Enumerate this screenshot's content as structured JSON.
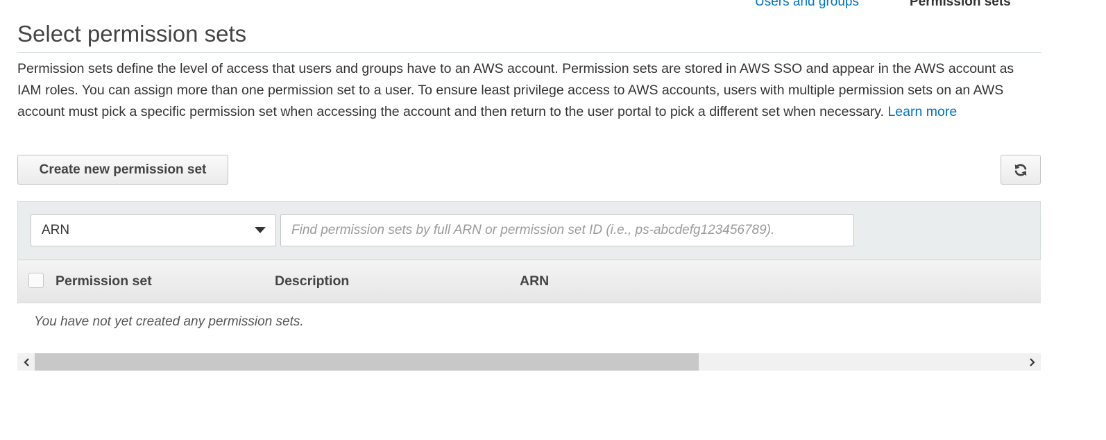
{
  "steps": {
    "users_and_groups": "Users and groups",
    "permission_sets": "Permission sets"
  },
  "page": {
    "title": "Select permission sets",
    "description": "Permission sets define the level of access that users and groups have to an AWS account. Permission sets are stored in AWS SSO and appear in the AWS account as IAM roles. You can assign more than one permission set to a user. To ensure least privilege access to AWS accounts, users with multiple permission sets on an AWS account must pick a specific permission set when accessing the account and then return to the user portal to pick a different set when necessary.",
    "learn_more": "Learn more"
  },
  "toolbar": {
    "create_label": "Create new permission set",
    "refresh_icon": "refresh-icon"
  },
  "filter": {
    "selected": "ARN",
    "placeholder": "Find permission sets by full ARN or permission set ID (i.e., ps-abcdefg123456789)."
  },
  "table": {
    "columns": [
      "Permission set",
      "Description",
      "ARN"
    ],
    "empty_message": "You have not yet created any permission sets."
  },
  "colors": {
    "link": "#0073bb",
    "text": "#333333",
    "panel": "#eaeded"
  }
}
